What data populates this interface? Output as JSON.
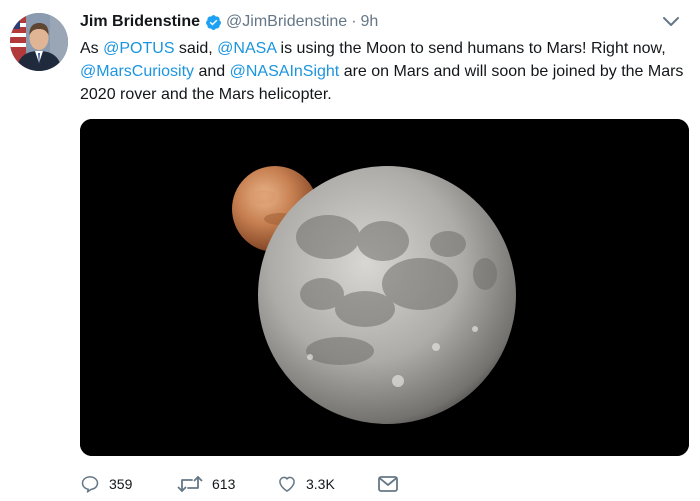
{
  "author": {
    "name": "Jim Bridenstine",
    "handle": "@JimBridenstine",
    "separator": "·",
    "time": "9h"
  },
  "tweet": {
    "segments": [
      {
        "text": "As ",
        "mention": false
      },
      {
        "text": "@POTUS",
        "mention": true
      },
      {
        "text": " said, ",
        "mention": false
      },
      {
        "text": "@NASA",
        "mention": true
      },
      {
        "text": " is using the Moon to send humans to Mars! Right now, ",
        "mention": false
      },
      {
        "text": "@MarsCuriosity",
        "mention": true
      },
      {
        "text": " and ",
        "mention": false
      },
      {
        "text": "@NASAInSight",
        "mention": true
      },
      {
        "text": " are on Mars and will soon be joined by the Mars 2020 rover and the Mars helicopter.",
        "mention": false
      }
    ]
  },
  "actions": {
    "reply_count": "359",
    "retweet_count": "613",
    "like_count": "3.3K"
  },
  "icons": {
    "verified": "verified-badge-icon",
    "caret": "chevron-down-icon",
    "reply": "reply-icon",
    "retweet": "retweet-icon",
    "like": "heart-icon",
    "dm": "envelope-icon"
  },
  "colors": {
    "link": "#1b95e0",
    "secondary_text": "#657786",
    "primary_text": "#14171a",
    "verified": "#1da1f2"
  }
}
